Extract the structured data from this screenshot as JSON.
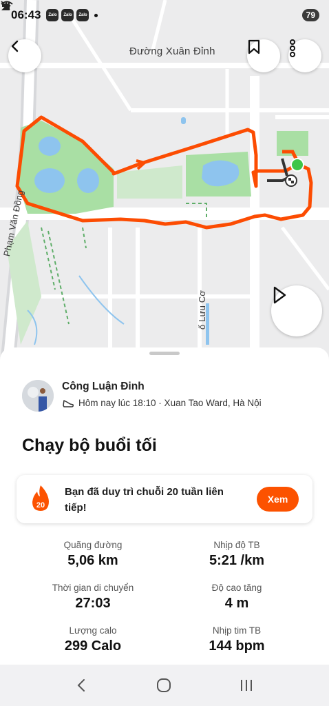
{
  "status": {
    "time": "06:43",
    "apps": [
      "Zalo",
      "Zalo",
      "Zalo"
    ],
    "battery": "79"
  },
  "map": {
    "labels": {
      "street_top": "Đường Xuân Đỉnh",
      "street_left": "Phạm Văn Đồng",
      "street_bottom": "ố Lưu Cơ"
    },
    "route_color": "#fc4c02"
  },
  "activity": {
    "athlete_name": "Công Luận Đinh",
    "meta": "Hôm nay lúc 18:10 · Xuan Tao Ward, Hà Nội",
    "title": "Chạy bộ buổi tối",
    "streak": {
      "count": "20",
      "text": "Bạn đã duy trì chuỗi 20 tuần liên tiếp!",
      "button": "Xem"
    },
    "stats": [
      {
        "label": "Quãng đường",
        "value": "5,06 km"
      },
      {
        "label": "Nhịp độ TB",
        "value": "5:21 /km"
      },
      {
        "label": "Thời gian di chuyển",
        "value": "27:03"
      },
      {
        "label": "Độ cao tăng",
        "value": "4 m"
      },
      {
        "label": "Lượng calo",
        "value": "299 Calo"
      },
      {
        "label": "Nhịp tim TB",
        "value": "144 bpm"
      }
    ]
  },
  "colors": {
    "accent": "#fc5200",
    "park": "#a9dfa4",
    "water": "#8ec4ee"
  }
}
